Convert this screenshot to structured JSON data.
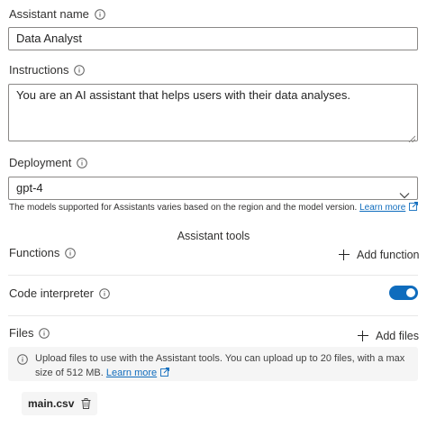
{
  "assistant_name": {
    "label": "Assistant name",
    "value": "Data Analyst"
  },
  "instructions": {
    "label": "Instructions",
    "value": "You are an AI assistant that helps users with their data analyses."
  },
  "deployment": {
    "label": "Deployment",
    "selected": "gpt-4",
    "helper_text": "The models supported for Assistants varies based on the region and the model version.",
    "learn_more": "Learn more"
  },
  "assistant_tools": {
    "title": "Assistant tools",
    "functions": {
      "label": "Functions",
      "add_label": "Add function"
    },
    "code_interpreter": {
      "label": "Code interpreter",
      "enabled": true
    },
    "files": {
      "label": "Files",
      "add_label": "Add files",
      "info_text": "Upload files to use with the Assistant tools. You can upload up to 20 files, with a max size of 512 MB.",
      "learn_more": "Learn more",
      "items": [
        {
          "name": "main.csv"
        }
      ]
    }
  },
  "colors": {
    "accent": "#0f6cbd",
    "border": "#8a8886",
    "info_bg": "#f5f5f5"
  }
}
